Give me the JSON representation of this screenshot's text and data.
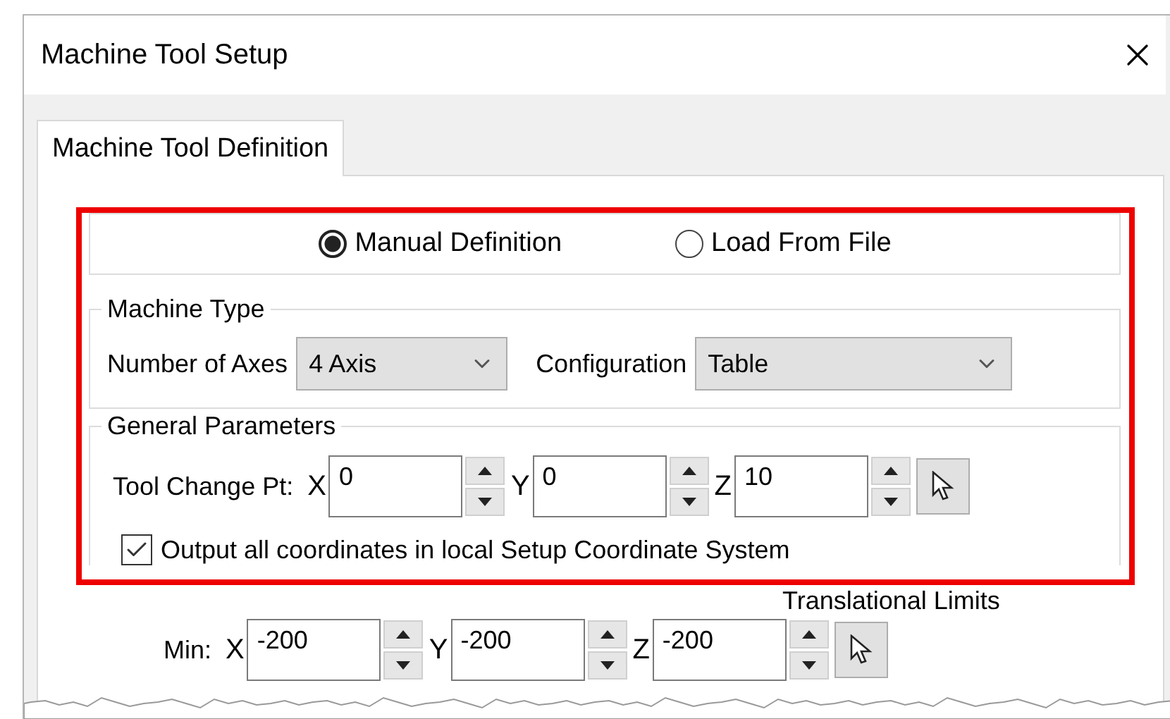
{
  "window": {
    "title": "Machine Tool Setup"
  },
  "tabs": [
    {
      "label": "Machine Tool Definition",
      "selected": true
    }
  ],
  "definition_mode": [
    {
      "label": "Manual Definition",
      "selected": true
    },
    {
      "label": "Load From File",
      "selected": false
    }
  ],
  "machine_type": {
    "title": "Machine Type",
    "fields": [
      {
        "label": "Number of Axes",
        "value": "4 Axis"
      },
      {
        "label": "Configuration",
        "value": "Table"
      }
    ]
  },
  "general_parameters": {
    "title": "General Parameters",
    "tool_change_pt": {
      "label": "Tool Change Pt:",
      "coords": [
        {
          "axis": "X",
          "value": "0"
        },
        {
          "axis": "Y",
          "value": "0"
        },
        {
          "axis": "Z",
          "value": "10"
        }
      ]
    },
    "output_local": {
      "label": "Output all coordinates in local Setup Coordinate System",
      "checked": true
    }
  },
  "translational_limits": {
    "title": "Translational Limits",
    "min": {
      "label": "Min:",
      "coords": [
        {
          "axis": "X",
          "value": "-200"
        },
        {
          "axis": "Y",
          "value": "-200"
        },
        {
          "axis": "Z",
          "value": "-200"
        }
      ]
    }
  }
}
